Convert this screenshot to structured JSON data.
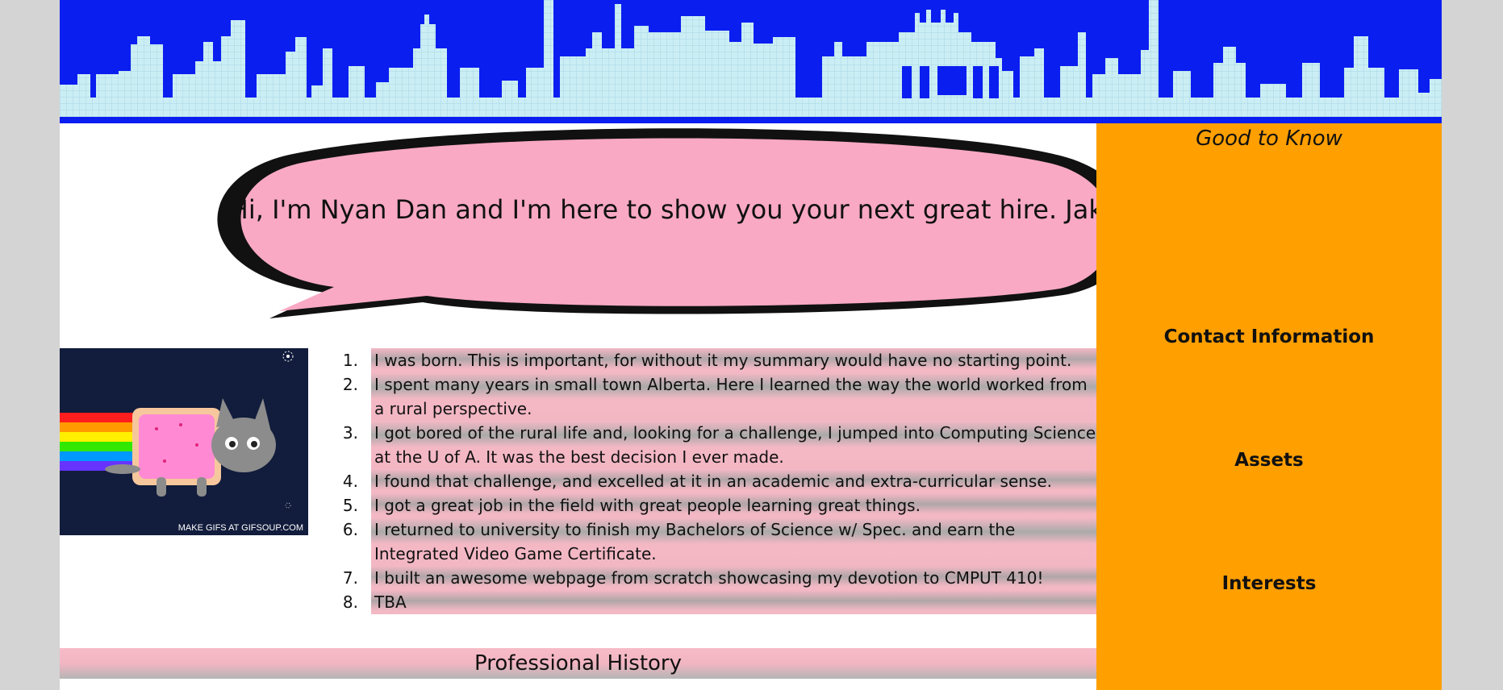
{
  "speech_bubble": {
    "text": "Hi, I'm Nyan Dan and I'm here to show you your next great hire. Jake!"
  },
  "nyan_image": {
    "caption": "MAKE GIFS AT GIFSOUP.COM"
  },
  "summary": {
    "items": [
      {
        "num": "1.",
        "text": "I was born. This is important, for without it my summary would have no starting point."
      },
      {
        "num": "2.",
        "text": "I spent many years in small town Alberta. Here I learned the way the world worked from a rural perspective."
      },
      {
        "num": "3.",
        "text": "I got bored of the rural life and, looking for a challenge, I jumped into Computing Science at the U of A. It was the best decision I ever made."
      },
      {
        "num": "4.",
        "text": "I found that challenge, and excelled at it in an academic and extra-curricular sense."
      },
      {
        "num": "5.",
        "text": "I got a great job in the field with great people learning great things."
      },
      {
        "num": "6.",
        "text": "I returned to university to finish my Bachelors of Science w/ Spec. and earn the Integrated Video Game Certificate."
      },
      {
        "num": "7.",
        "text": "I built an awesome webpage from scratch showcasing my devotion to CMPUT 410!"
      },
      {
        "num": "8.",
        "text": "TBA"
      }
    ]
  },
  "section": {
    "professional_history": "Professional History"
  },
  "sidebar": {
    "title": "Good to Know",
    "links": [
      "Contact Information",
      "Assets",
      "Interests"
    ]
  },
  "colors": {
    "banner_blue": "#0b1ef0",
    "skyline": "#cbeef5",
    "sidebar_orange": "#ff9f00",
    "bubble_pink": "#f9a9c4"
  }
}
